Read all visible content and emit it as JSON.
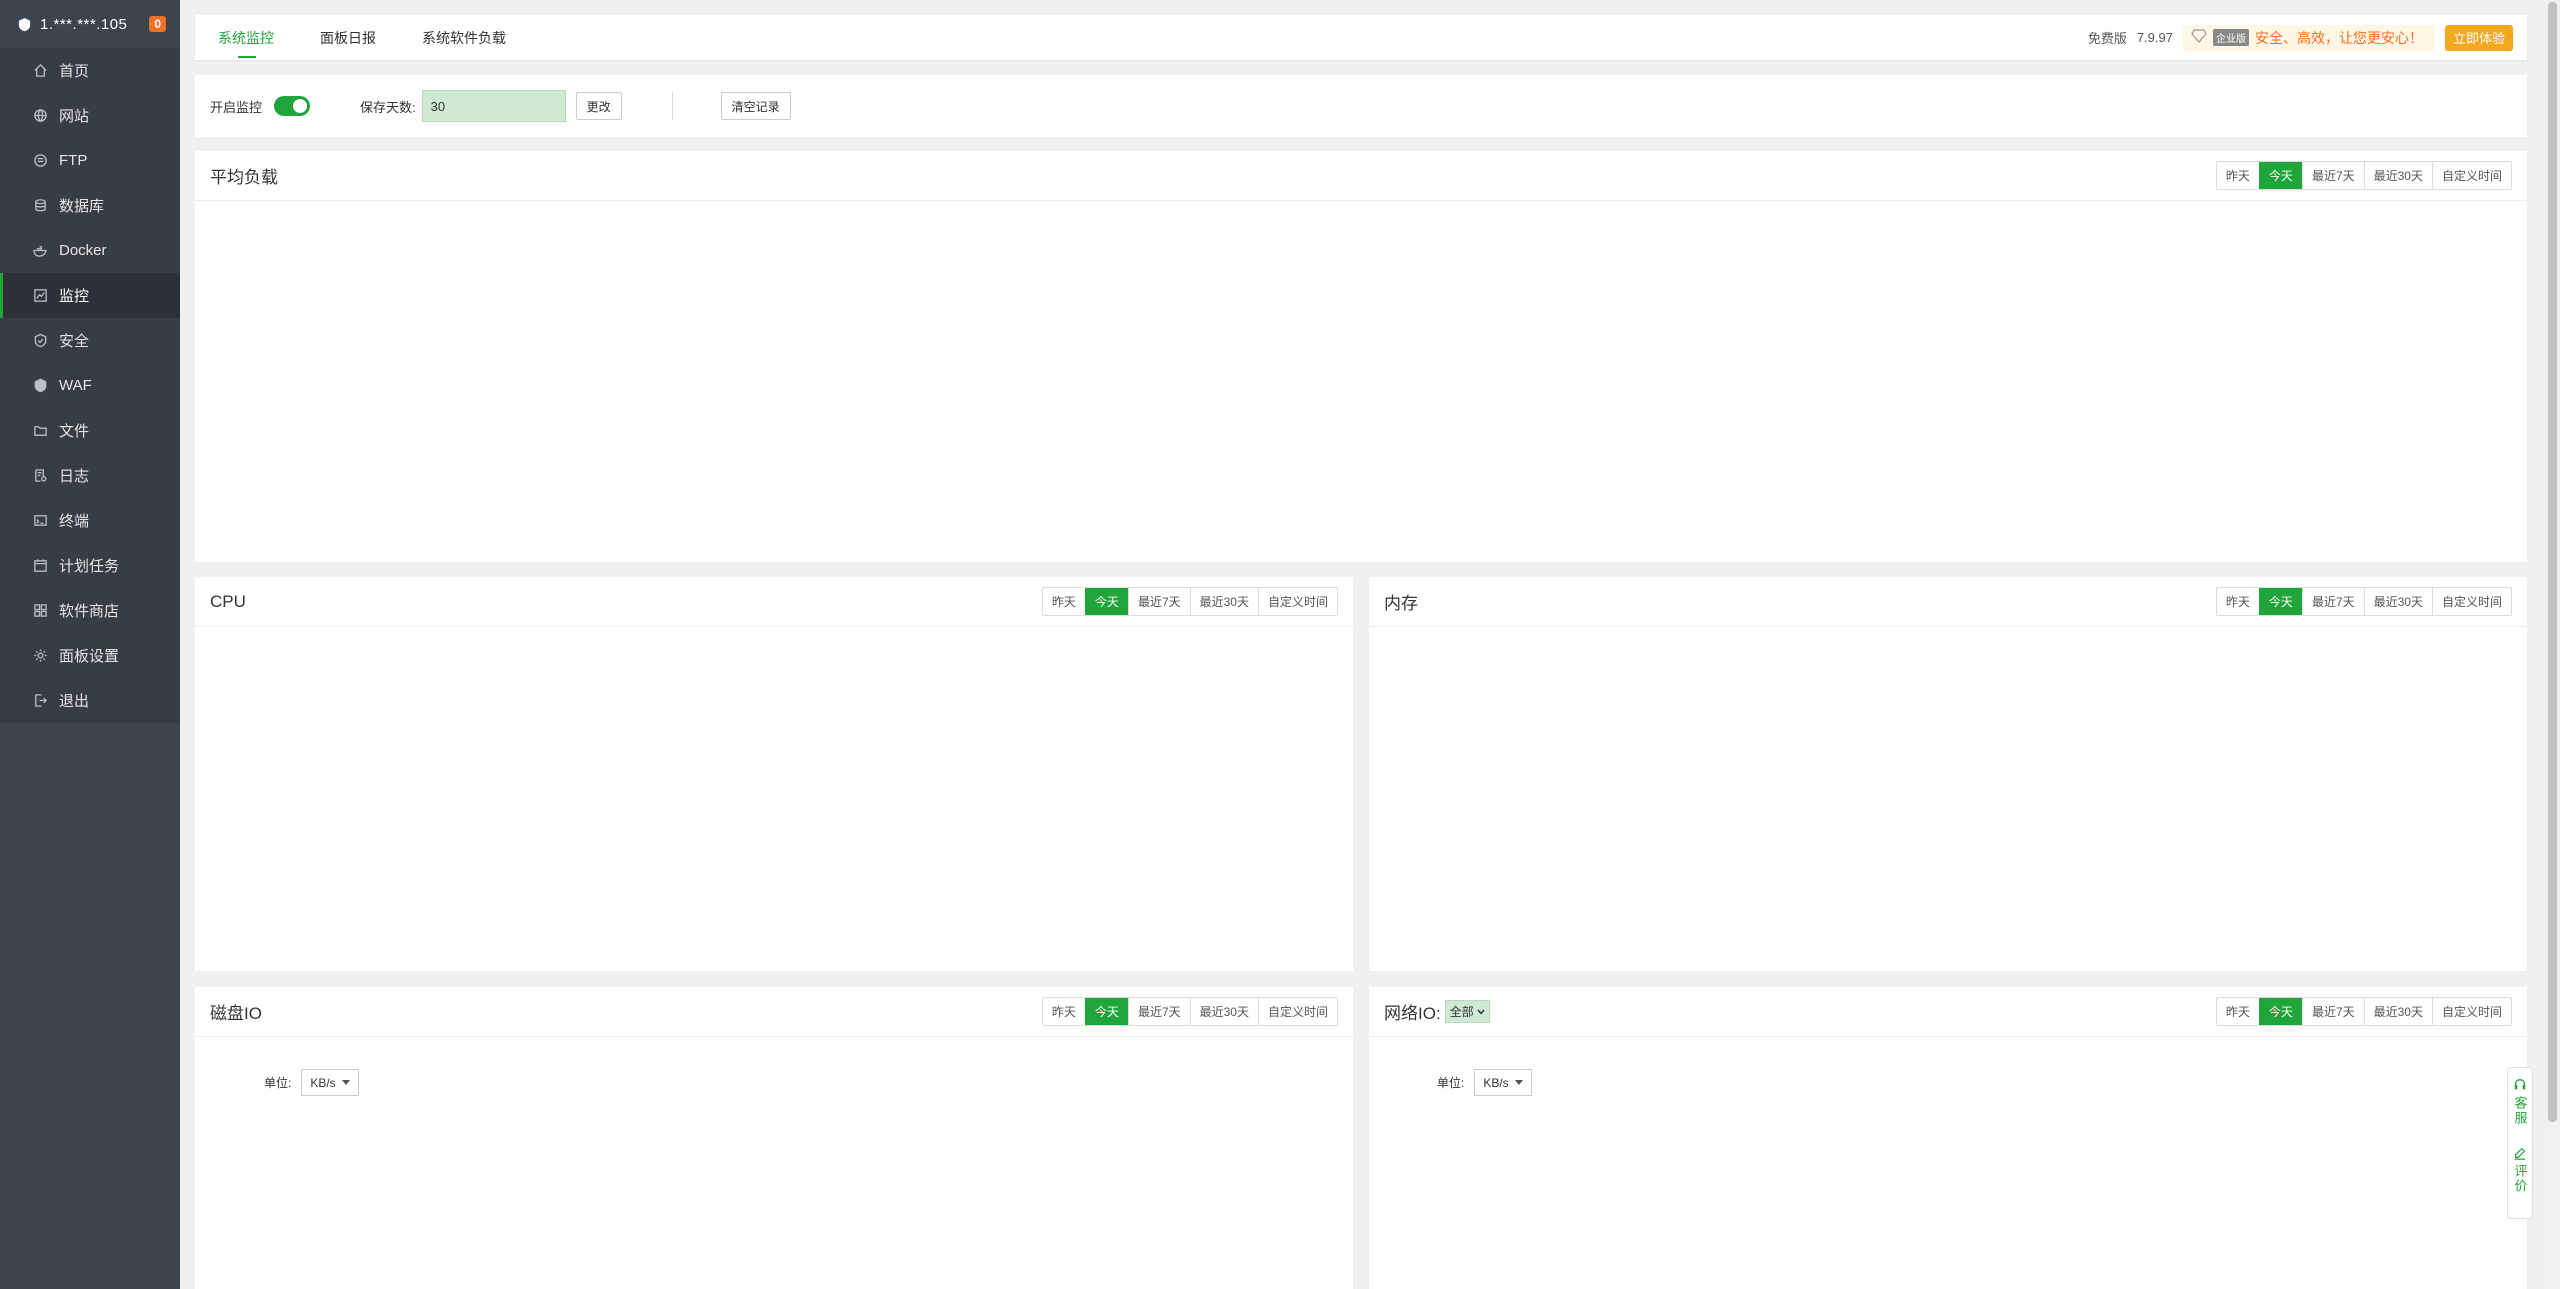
{
  "sidebar": {
    "host": "1.***.***.105",
    "badge": "0",
    "items": [
      {
        "label": "首页",
        "icon": "home-icon"
      },
      {
        "label": "网站",
        "icon": "globe-icon"
      },
      {
        "label": "FTP",
        "icon": "ftp-icon"
      },
      {
        "label": "数据库",
        "icon": "database-icon"
      },
      {
        "label": "Docker",
        "icon": "docker-icon"
      },
      {
        "label": "监控",
        "icon": "monitor-icon"
      },
      {
        "label": "安全",
        "icon": "shield-icon"
      },
      {
        "label": "WAF",
        "icon": "waf-icon"
      },
      {
        "label": "文件",
        "icon": "folder-icon"
      },
      {
        "label": "日志",
        "icon": "log-icon"
      },
      {
        "label": "终端",
        "icon": "terminal-icon"
      },
      {
        "label": "计划任务",
        "icon": "calendar-icon"
      },
      {
        "label": "软件商店",
        "icon": "grid-icon"
      },
      {
        "label": "面板设置",
        "icon": "gear-icon"
      },
      {
        "label": "退出",
        "icon": "logout-icon"
      }
    ]
  },
  "topbar": {
    "tabs": [
      "系统监控",
      "面板日报",
      "系统软件负载"
    ],
    "edition": "免费版",
    "version": "7.9.97",
    "promo_tag": "企业版",
    "promo_text": "安全、高效，让您更安心！",
    "try_label": "立即体验"
  },
  "settings": {
    "enable_label": "开启监控",
    "enabled": true,
    "days_label": "保存天数:",
    "days_value": "30",
    "change_label": "更改",
    "clear_label": "清空记录"
  },
  "ranges": [
    "昨天",
    "今天",
    "最近7天",
    "最近30天",
    "自定义时间"
  ],
  "cards": {
    "load_title": "平均负载",
    "cpu_title": "CPU",
    "mem_title": "内存",
    "disk_title": "磁盘IO",
    "net_title": "网络IO:",
    "net_select": "全部",
    "unit_label": "单位:",
    "unit_value": "KB/s"
  },
  "float": {
    "service": "客服",
    "review": "评价"
  },
  "colors": {
    "accent": "#20a53a",
    "sidebar_bg": "#3c444d",
    "promo": "#fc6d26",
    "try_button": "#f4a81d"
  }
}
